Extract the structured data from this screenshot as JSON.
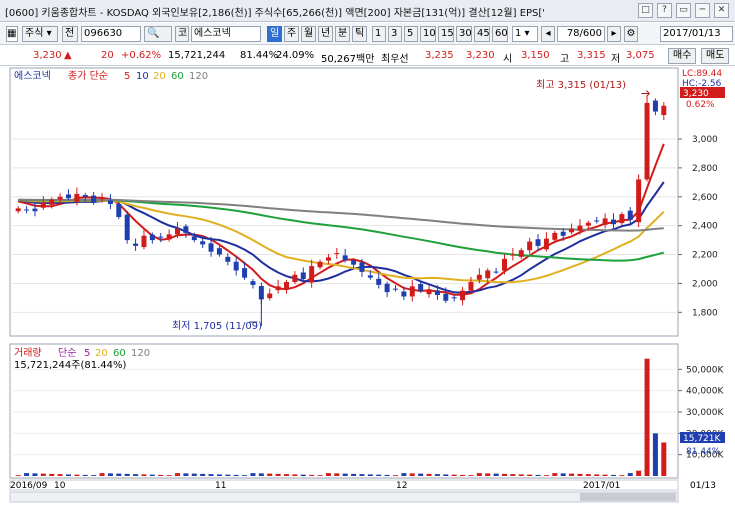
{
  "window": {
    "title": "[0600] 키움종합차트 - KOSDAQ 외국인보유[2,186(천)] 주식수[65,266(천)] 액면[200] 자본금[131(억)] 결산[12월] EPS['",
    "controls": [
      "□",
      "?",
      "▭",
      "─",
      "✕"
    ]
  },
  "toolbar": {
    "market": "주식",
    "all": "전",
    "code": "096630",
    "name_prefix": "코",
    "name": "에스코넥",
    "periods": [
      "일",
      "주",
      "월",
      "년",
      "분",
      "틱"
    ],
    "selected_period": "일",
    "intervals": [
      "1",
      "3",
      "5",
      "10",
      "15",
      "30",
      "45",
      "60"
    ],
    "tick_value": "1",
    "count": "78/600",
    "date": "2017/01/13"
  },
  "quote": {
    "price": "3,230",
    "arrow": "▲",
    "change": "20",
    "pct": "+0.62%",
    "volume": "15,721,244",
    "vol_ratio": "81.44%",
    "turnover": "24.09%",
    "amount": "50,267백만",
    "best_ask_label": "최우선",
    "best_ask": "3,235",
    "best_bid": "3,230",
    "open_label": "시",
    "open": "3,150",
    "high_label": "고",
    "high": "3,315",
    "low_label": "저",
    "low": "3,075",
    "buy_label": "매수",
    "sell_label": "매도"
  },
  "price_panel": {
    "legend_name": "에스코넥",
    "legend_ma_label": "종가 단순",
    "ma_periods": [
      "5",
      "10",
      "20",
      "60",
      "120"
    ],
    "ma_colors": [
      "#d21c1c",
      "#1f2fa0",
      "#e0b020",
      "#1ea03a",
      "#808080"
    ],
    "lc_label": "LC:89.44",
    "hc_label": "HC:-2.56",
    "price_badge": "3,230",
    "pct_badge": "0.62%",
    "high_annotation": "최고 3,315 (01/13)",
    "low_annotation": "최저 1,705 (11/09)",
    "y_ticks": [
      "3,000",
      "2,800",
      "2,600",
      "2,400",
      "2,200",
      "2,000",
      "1,800"
    ],
    "y_tick_values": [
      3000,
      2800,
      2600,
      2400,
      2200,
      2000,
      1800
    ]
  },
  "volume_panel": {
    "legend_label": "거래량",
    "legend_ma_label": "단순",
    "ma_periods": [
      "5",
      "20",
      "60",
      "120"
    ],
    "subtitle": "15,721,244주(81.44%)",
    "y_ticks": [
      "50,000K",
      "40,000K",
      "30,000K",
      "20,000K",
      "10,000K"
    ],
    "y_tick_values": [
      50000,
      40000,
      30000,
      20000,
      10000
    ],
    "badge_value": "15,721K",
    "badge_pct": "81.44%"
  },
  "x_axis": {
    "labels": [
      "2016/09",
      "10",
      "11",
      "12",
      "2017/01",
      "01/13"
    ]
  },
  "chart_data": {
    "type": "candlestick",
    "series_prices": [
      2520,
      2510,
      2500,
      2560,
      2580,
      2600,
      2590,
      2620,
      2600,
      2560,
      2590,
      2550,
      2460,
      2300,
      2260,
      2330,
      2300,
      2320,
      2340,
      2380,
      2350,
      2300,
      2270,
      2220,
      2200,
      2150,
      2090,
      2040,
      1990,
      1890,
      1930,
      1980,
      2010,
      2060,
      2030,
      2120,
      2150,
      2180,
      2210,
      2160,
      2130,
      2080,
      2040,
      1990,
      1940,
      1960,
      1910,
      1980,
      1950,
      1960,
      1920,
      1880,
      1900,
      1950,
      2010,
      2060,
      2090,
      2080,
      2170,
      2200,
      2230,
      2290,
      2260,
      2310,
      2350,
      2330,
      2380,
      2400,
      2420,
      2430,
      2450,
      2410,
      2480,
      2440,
      2720,
      3250,
      3190,
      3230
    ],
    "annotations": {
      "high": 3315,
      "low": 1705
    }
  }
}
